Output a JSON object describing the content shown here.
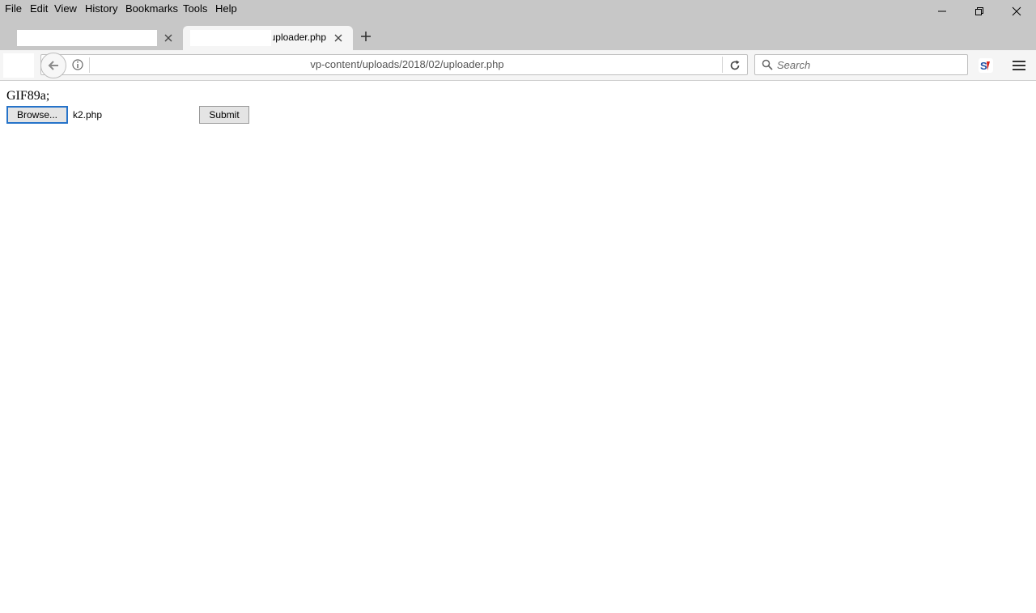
{
  "menu": {
    "file": "File",
    "edit": "Edit",
    "view": "View",
    "history": "History",
    "bookmarks": "Bookmarks",
    "tools": "Tools",
    "help": "Help"
  },
  "tabs": {
    "active_title": "uploader.php"
  },
  "navbar": {
    "url": "vp-content/uploads/2018/02/uploader.php",
    "search_placeholder": "Search"
  },
  "page": {
    "heading": "GIF89a;",
    "browse_label": "Browse...",
    "selected_file": "k2.php",
    "submit_label": "Submit"
  },
  "colors": {
    "chrome": "#c7c7c7",
    "toolbar": "#f5f5f5",
    "focus_ring": "#2673c9"
  },
  "icons": [
    "minimize-icon",
    "restore-icon",
    "close-icon",
    "tab-close-icon",
    "plus-icon",
    "back-arrow-icon",
    "info-icon",
    "reload-icon",
    "search-icon",
    "extension-icon",
    "hamburger-menu-icon"
  ]
}
